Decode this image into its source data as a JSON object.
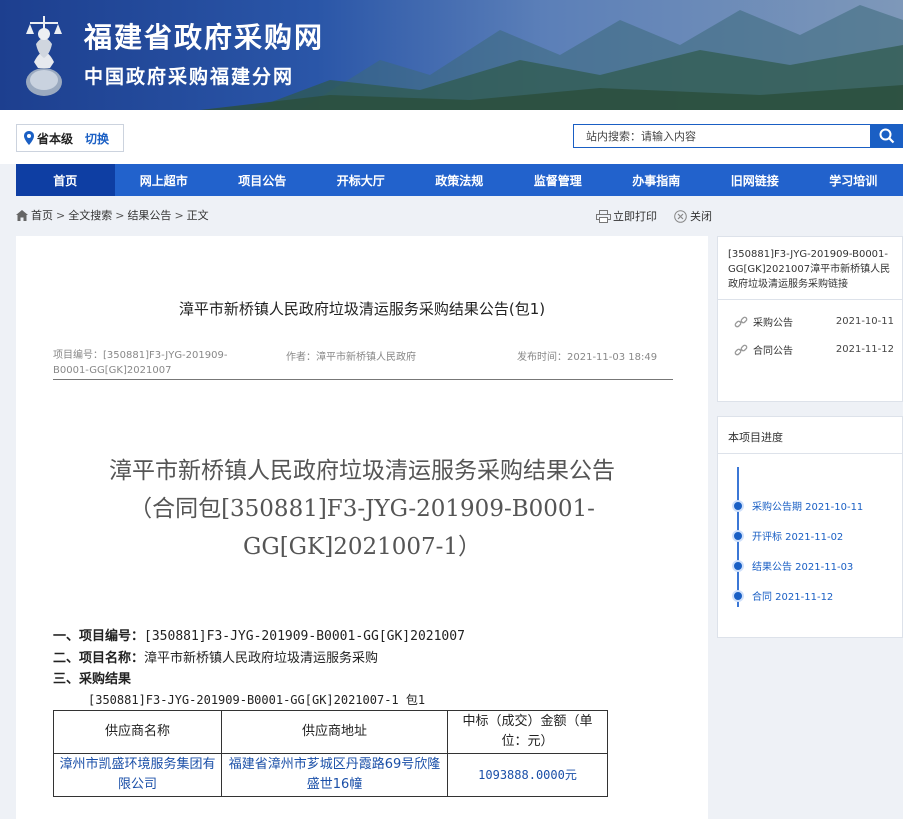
{
  "header": {
    "title": "福建省政府采购网",
    "subtitle": "中国政府采购福建分网"
  },
  "topbar": {
    "region": "省本级",
    "switch_label": "切换",
    "search_placeholder": "站内搜索：请输入内容"
  },
  "nav": {
    "items": [
      {
        "label": "首页"
      },
      {
        "label": "网上超市"
      },
      {
        "label": "项目公告"
      },
      {
        "label": "开标大厅"
      },
      {
        "label": "政策法规"
      },
      {
        "label": "监督管理"
      },
      {
        "label": "办事指南"
      },
      {
        "label": "旧网链接"
      },
      {
        "label": "学习培训"
      }
    ]
  },
  "breadcrumb": [
    "首页",
    "全文搜索",
    "结果公告",
    "正文"
  ],
  "breadcrumb_sep": ">",
  "actions": {
    "print": "立即打印",
    "close": "关闭"
  },
  "article": {
    "title": "漳平市新桥镇人民政府垃圾清运服务采购结果公告(包1)",
    "meta": {
      "project_no": "项目编号：[350881]F3-JYG-201909-B0001-GG[GK]2021007",
      "author": "作者：漳平市新桥镇人民政府",
      "published": "发布时间：2021-11-03 18:49"
    },
    "doc_title_line1": "漳平市新桥镇人民政府垃圾清运服务采购结果公告",
    "doc_title_line2": "（合同包[350881]F3-JYG-201909-B0001-",
    "doc_title_line3": "GG[GK]2021007-1）",
    "sec1_label": "一、项目编号：",
    "sec1_value": "[350881]F3-JYG-201909-B0001-GG[GK]2021007",
    "sec2_label": "二、项目名称：",
    "sec2_value": "漳平市新桥镇人民政府垃圾清运服务采购",
    "sec3_label": "三、采购结果",
    "result_sub": "[350881]F3-JYG-201909-B0001-GG[GK]2021007-1 包1",
    "table": {
      "headers": [
        "供应商名称",
        "供应商地址",
        "中标（成交）金额（单位：元）"
      ],
      "rows": [
        [
          "漳州市凯盛环境服务集团有限公司",
          "福建省漳州市芗城区丹霞路69号欣隆盛世16幢",
          "1093888.0000元"
        ]
      ]
    }
  },
  "sidebar": {
    "related_title": "[350881]F3-JYG-201909-B0001-GG[GK]2021007漳平市新桥镇人民政府垃圾清运服务采购链接",
    "related": [
      {
        "label": "采购公告",
        "date": "2021-10-11"
      },
      {
        "label": "合同公告",
        "date": "2021-11-12"
      }
    ],
    "progress_title": "本项目进度",
    "progress": [
      "采购公告期 2021-10-11",
      "开评标 2021-11-02",
      "结果公告 2021-11-03",
      "合同 2021-11-12"
    ]
  },
  "colors": {
    "nav_bg": "#2262cc",
    "nav_active": "#0e3ea3",
    "accent": "#1a5fc4"
  }
}
